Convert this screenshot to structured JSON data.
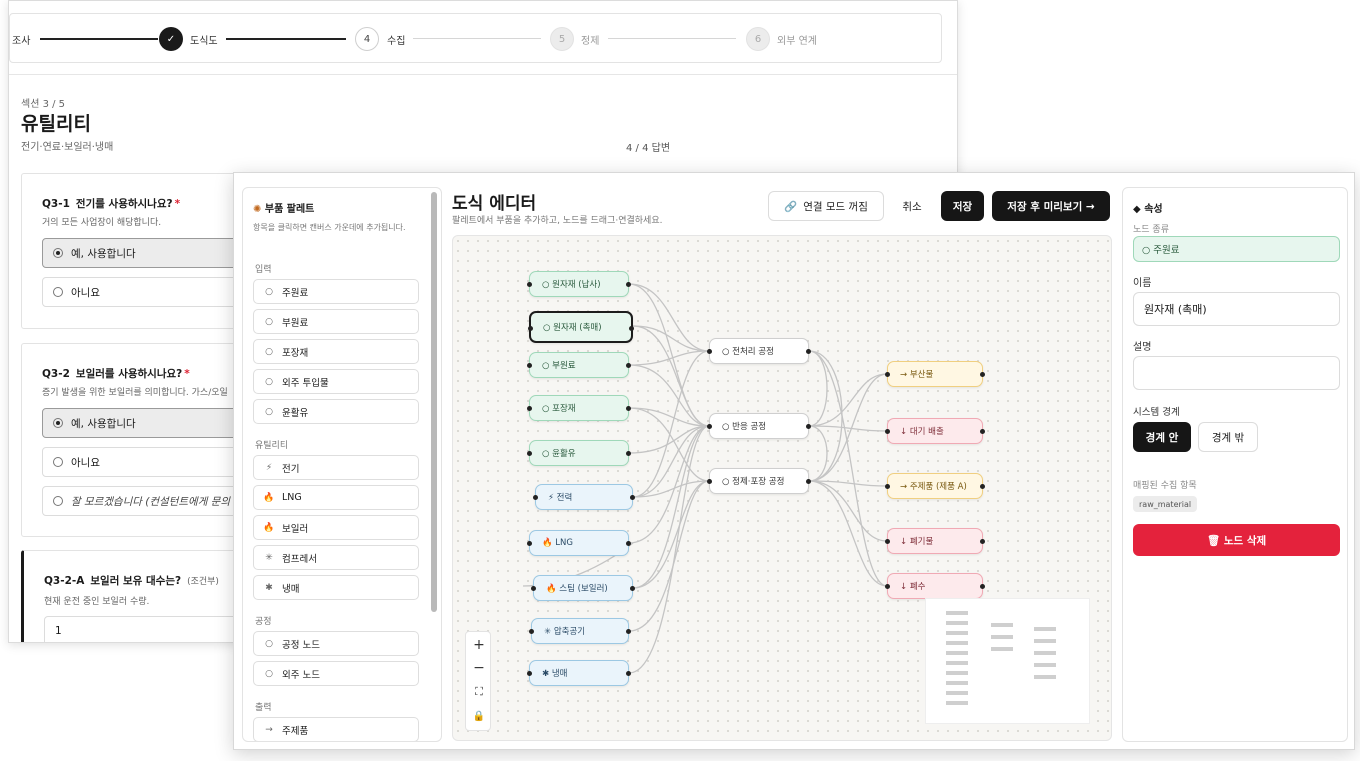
{
  "survey": {
    "steps": [
      {
        "label": "조사"
      },
      {
        "num": "✓",
        "label": "도식도"
      },
      {
        "num": "4",
        "label": "수집"
      },
      {
        "num": "5",
        "label": "정제"
      },
      {
        "num": "6",
        "label": "외부 연계"
      }
    ],
    "section_label": "섹션 3 / 5",
    "section_title": "유틸리티",
    "section_subtitle": "전기·연료·보일러·냉매",
    "answer_count": "4 / 4 답변",
    "questions": [
      {
        "id": "Q3-1",
        "title": "전기를 사용하시나요?",
        "required": "*",
        "hint": "거의 모든 사업장이 해당합니다.",
        "options": [
          "예, 사용합니다",
          "아니요"
        ]
      },
      {
        "id": "Q3-2",
        "title": "보일러를 사용하시나요?",
        "required": "*",
        "hint": "증기 발생을 위한 보일러를 의미합니다. 가스/오일",
        "options": [
          "예, 사용합니다",
          "아니요",
          "잘 모르겠습니다 (컨설턴트에게 문의"
        ]
      },
      {
        "id": "Q3-2-A",
        "title": "보일러 보유 대수는?",
        "tag": "(조건부)",
        "hint": "현재 운전 중인 보일러 수량.",
        "value": "1"
      }
    ]
  },
  "editor": {
    "palette": {
      "title": "부품 팔레트",
      "help": "항목을 클릭하면 캔버스 가운데에 추가됩니다.",
      "groups": [
        {
          "label": "입력",
          "items": [
            {
              "icon": "○",
              "label": "주원료"
            },
            {
              "icon": "○",
              "label": "부원료"
            },
            {
              "icon": "○",
              "label": "포장재"
            },
            {
              "icon": "○",
              "label": "외주 투입물"
            },
            {
              "icon": "○",
              "label": "윤활유"
            }
          ]
        },
        {
          "label": "유틸리티",
          "items": [
            {
              "icon": "⚡",
              "label": "전기"
            },
            {
              "icon": "🔥",
              "label": "LNG"
            },
            {
              "icon": "🔥",
              "label": "보일러"
            },
            {
              "icon": "✳",
              "label": "컴프레서"
            },
            {
              "icon": "✱",
              "label": "냉매"
            }
          ]
        },
        {
          "label": "공정",
          "items": [
            {
              "icon": "○",
              "label": "공정 노드"
            },
            {
              "icon": "○",
              "label": "외주 노드"
            }
          ]
        },
        {
          "label": "출력",
          "items": [
            {
              "icon": "→",
              "label": "주제품"
            }
          ]
        }
      ]
    },
    "title": "도식 에디터",
    "subtitle": "팔레트에서 부품을 추가하고, 노드를 드래그·연결하세요.",
    "buttons": {
      "connect_mode": "연결 모드 꺼짐",
      "cancel": "취소",
      "save": "저장",
      "save_preview": "저장 후 미리보기 →"
    },
    "nodes": {
      "in1": "○ 원자재 (납사)",
      "in2": "○ 원자재 (촉매)",
      "in3": "○ 부원료",
      "in4": "○ 포장재",
      "in5": "○ 윤활유",
      "u1": "⚡ 전력",
      "u2": "🔥 LNG",
      "u3": "🔥 스팀 (보일러)",
      "u4": "✳ 압축공기",
      "u5": "✱ 냉매",
      "p1": "○ 전처리 공정",
      "p2": "○ 반응 공정",
      "p3": "○ 정제·포장 공정",
      "o1": "→ 부산물",
      "o2": "↓ 대기 배출",
      "o3": "→ 주제품 (제품 A)",
      "o4": "↓ 폐기물",
      "o5": "↓ 폐수"
    },
    "zoom_controls": [
      "+",
      "−",
      "⛶",
      "🔒"
    ],
    "properties": {
      "title": "속성",
      "node_type_label": "노드 종류",
      "node_type": "○ 주원료",
      "name_label": "이름",
      "name_value": "원자재 (촉매)",
      "desc_label": "설명",
      "desc_value": "",
      "boundary_label": "시스템 경계",
      "boundary_in": "경계 안",
      "boundary_out": "경계 밖",
      "mapped_label": "매핑된 수집 항목",
      "mapped_chip": "raw_material",
      "delete": "🗑 노드 삭제"
    },
    "colors": {
      "input": "#e7f6ee",
      "utility": "#eaf4fb",
      "output": "#fff7e3",
      "emission": "#fdeaec",
      "danger": "#e4223c"
    }
  }
}
